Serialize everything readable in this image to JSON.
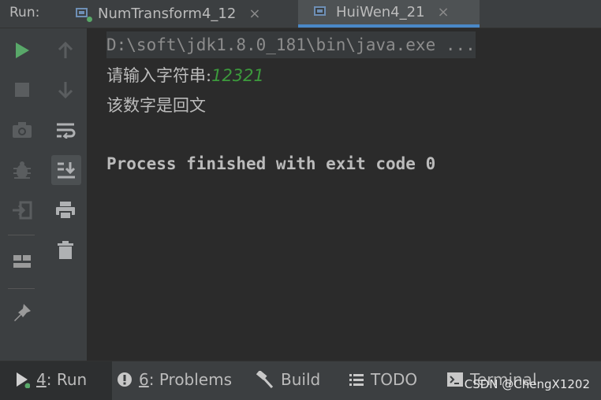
{
  "header": {
    "run_label": "Run:",
    "tabs": [
      {
        "label": "NumTransform4_12",
        "close": "×",
        "active": false
      },
      {
        "label": "HuiWen4_21",
        "close": "×",
        "active": true
      }
    ]
  },
  "toolbar_left": {
    "icons": [
      "run-icon",
      "stop-icon",
      "camera-icon",
      "debug-icon",
      "exit-icon",
      "layout-icon",
      "pin-icon"
    ]
  },
  "toolbar_right": {
    "icons": [
      "up-arrow-icon",
      "down-arrow-icon",
      "soft-wrap-icon",
      "scroll-to-end-icon",
      "print-icon",
      "trash-icon"
    ]
  },
  "console": {
    "command": "D:\\soft\\jdk1.8.0_181\\bin\\java.exe ...",
    "prompt": "请输入字符串:",
    "input_value": "12321",
    "result": "该数字是回文",
    "finished": "Process finished with exit code 0"
  },
  "bottom_tabs": [
    {
      "mnemonic": "4",
      "label": ": Run",
      "active": true
    },
    {
      "mnemonic": "6",
      "label": ": Problems",
      "active": false
    },
    {
      "mnemonic": "",
      "label": "Build",
      "active": false
    },
    {
      "mnemonic": "",
      "label": "TODO",
      "active": false
    },
    {
      "mnemonic": "",
      "label": "Terminal",
      "active": false
    }
  ],
  "watermark": "CSDN @ChengX1202",
  "colors": {
    "accent": "#4a88c7",
    "run_green": "#59a869",
    "input_green": "#3c9a3c"
  }
}
